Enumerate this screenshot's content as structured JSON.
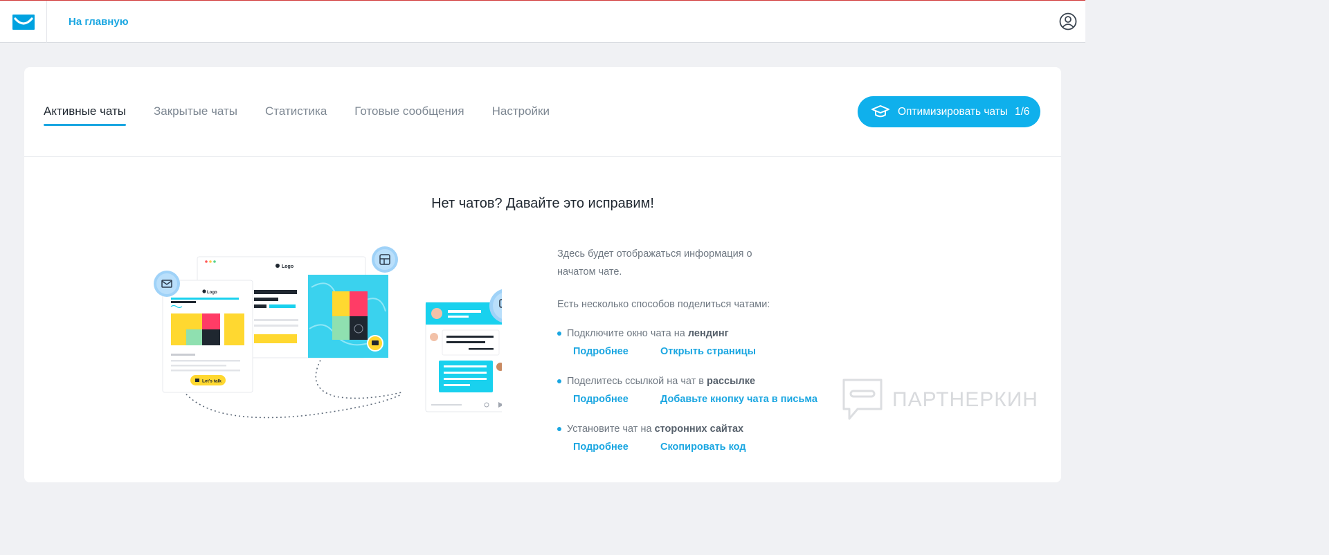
{
  "header": {
    "home_link": "На главную"
  },
  "tabs": [
    {
      "label": "Активные чаты",
      "active": true
    },
    {
      "label": "Закрытые чаты",
      "active": false
    },
    {
      "label": "Статистика",
      "active": false
    },
    {
      "label": "Готовые сообщения",
      "active": false
    },
    {
      "label": "Настройки",
      "active": false
    }
  ],
  "optimize_button": {
    "label": "Оптимизировать чаты",
    "counter": "1/6"
  },
  "empty_state": {
    "heading": "Нет чатов? Давайте это исправим!",
    "description": "Здесь будет отображаться информация о начатом чате.",
    "ways_intro": "Есть несколько способов поделиться чатами:",
    "options": [
      {
        "text": "Подключите окно чата на ",
        "bold": "лендинг",
        "more": "Подробнее",
        "action": "Открыть страницы"
      },
      {
        "text": "Поделитесь ссылкой на чат в ",
        "bold": "рассылке",
        "more": "Подробнее",
        "action": "Добавьте кнопку чата в письма"
      },
      {
        "text": "Установите чат на ",
        "bold": "сторонних сайтах",
        "more": "Подробнее",
        "action": "Скопировать код"
      }
    ]
  },
  "illustration": {
    "logo_text": "Logo",
    "cta_text": "Let's talk"
  },
  "watermark": "ПАРТНЕРКИН",
  "colors": {
    "accent": "#1aa6e1",
    "button": "#0fb0ec",
    "background": "#f0f1f4"
  }
}
